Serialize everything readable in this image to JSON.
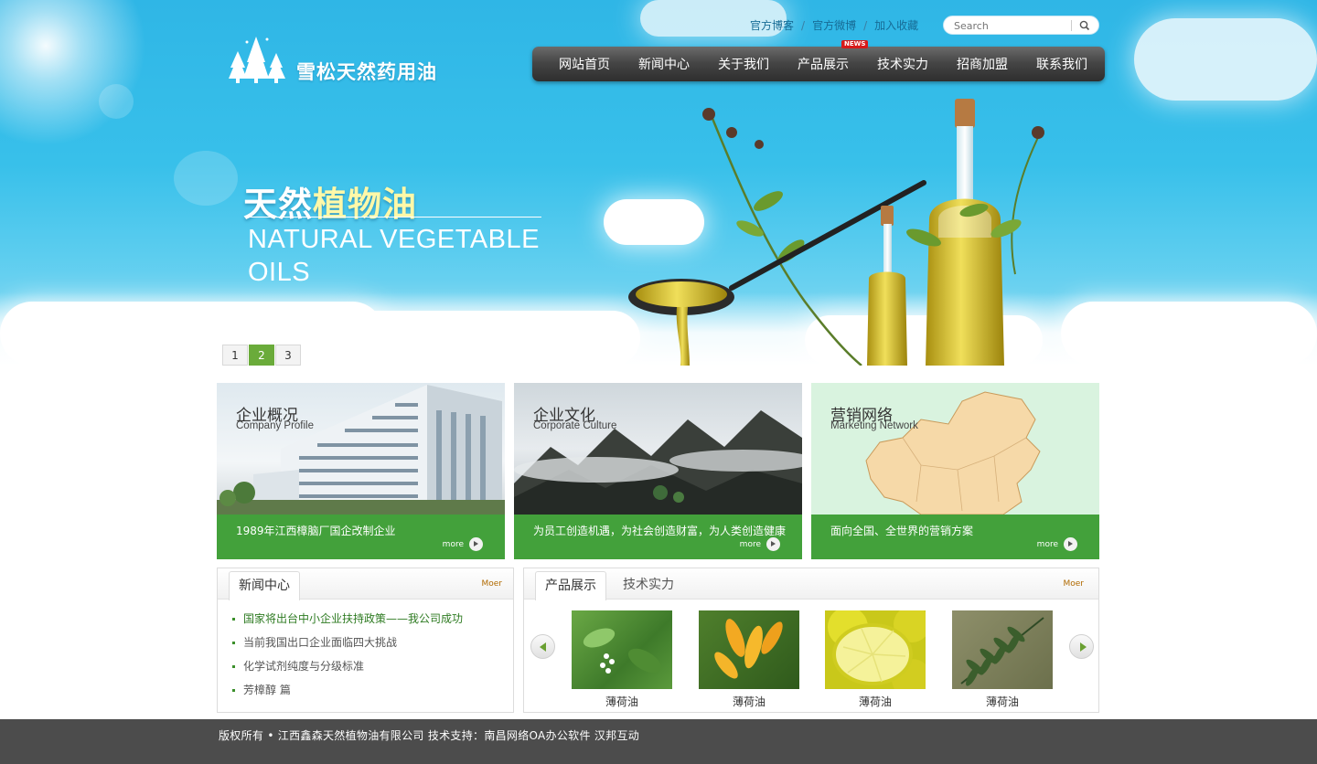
{
  "brand": {
    "name": "雪松天然药用油"
  },
  "top_links": [
    {
      "label": "官方博客"
    },
    {
      "label": "官方微博"
    },
    {
      "label": "加入收藏"
    }
  ],
  "search": {
    "placeholder": "Search"
  },
  "nav": {
    "items": [
      {
        "label": "网站首页"
      },
      {
        "label": "新闻中心"
      },
      {
        "label": "关于我们"
      },
      {
        "label": "产品展示",
        "badge": "NEWS"
      },
      {
        "label": "技术实力"
      },
      {
        "label": "招商加盟"
      },
      {
        "label": "联系我们"
      }
    ]
  },
  "hero": {
    "title_white": "天然",
    "title_yellow": "植物油",
    "subtitle": "NATURAL VEGETABLE OILS",
    "pages": [
      "1",
      "2",
      "3"
    ],
    "active_page": "2"
  },
  "features": [
    {
      "title": "企业概况",
      "subtitle": "Company Profile",
      "desc": "1989年江西樟脑厂国企改制企业",
      "more": "more"
    },
    {
      "title": "企业文化",
      "subtitle": "Corporate Culture",
      "desc": "为员工创造机遇，为社会创造财富，为人类创造健康",
      "more": "more"
    },
    {
      "title": "营销网络",
      "subtitle": "Marketing Network",
      "desc": "面向全国、全世界的营销方案",
      "more": "more"
    }
  ],
  "news": {
    "tab": "新闻中心",
    "more": "Moer",
    "items": [
      "国家将出台中小企业扶持政策——我公司成功",
      "当前我国出口企业面临四大挑战",
      "化学试剂纯度与分级标准",
      "芳樟醇 篇"
    ]
  },
  "products": {
    "tabs": [
      "产品展示",
      "技术实力"
    ],
    "more": "Moer",
    "items": [
      {
        "name": "薄荷油"
      },
      {
        "name": "薄荷油"
      },
      {
        "name": "薄荷油"
      },
      {
        "name": "薄荷油"
      }
    ]
  },
  "footer": {
    "text": "版权所有 • 江西鑫森天然植物油有限公司 技术支持：南昌网络OA办公软件  汉邦互动"
  },
  "colors": {
    "sky": "#38c0ea",
    "green": "#43a13b",
    "nav_dark": "#3a3a3a",
    "footer": "#4c4c4c"
  }
}
